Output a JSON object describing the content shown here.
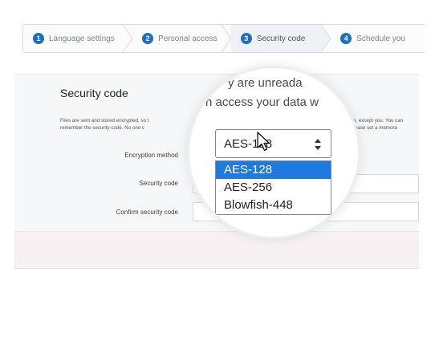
{
  "wizard": {
    "steps": [
      {
        "num": "1",
        "label": "Language settings"
      },
      {
        "num": "2",
        "label": "Personal access"
      },
      {
        "num": "3",
        "label": "Security code"
      },
      {
        "num": "4",
        "label": "Schedule you"
      }
    ],
    "active_step": 3
  },
  "section": {
    "title": "Security code",
    "description_lines": [
      "Files are sent and stored encrypted, so t",
      "remember the security code. No one c"
    ],
    "description_right_lines": [
      "one, except you. You can",
      ". Please set a memora"
    ]
  },
  "fields": {
    "encryption_label": "Encryption method",
    "security_code_label": "Security code",
    "confirm_label": "Confirm security code"
  },
  "magnifier": {
    "text_line1": "y are unreada",
    "text_line2": "n access your data w",
    "select_value": "AES-128",
    "options": [
      "AES-128",
      "AES-256",
      "Blowfish-448"
    ],
    "selected_option": "AES-128"
  },
  "colors": {
    "accent": "#1f6fc1",
    "selection": "#1f7ae0"
  }
}
